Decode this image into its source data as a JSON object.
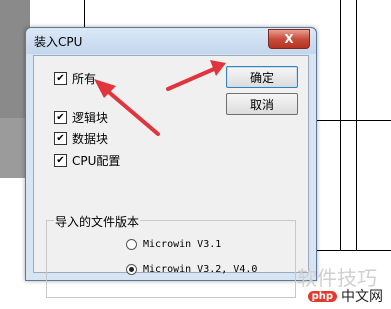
{
  "dialog": {
    "title": "装入CPU",
    "close_glyph": "X",
    "checkboxes": [
      {
        "label": "所有",
        "checked": true
      },
      {
        "label": "逻辑块",
        "checked": true
      },
      {
        "label": "数据块",
        "checked": true
      },
      {
        "label": "CPU配置",
        "checked": true
      }
    ],
    "ok_label": "确定",
    "cancel_label": "取消",
    "group_title": "导入的文件版本",
    "radios": [
      {
        "label": "Microwin V3.1",
        "selected": false
      },
      {
        "label": "Microwin V3.2, V4.0",
        "selected": true
      }
    ]
  },
  "watermark": "软件技巧",
  "logo": {
    "badge": "php",
    "text": "中文网"
  },
  "colors": {
    "arrow": "#e0353d"
  }
}
